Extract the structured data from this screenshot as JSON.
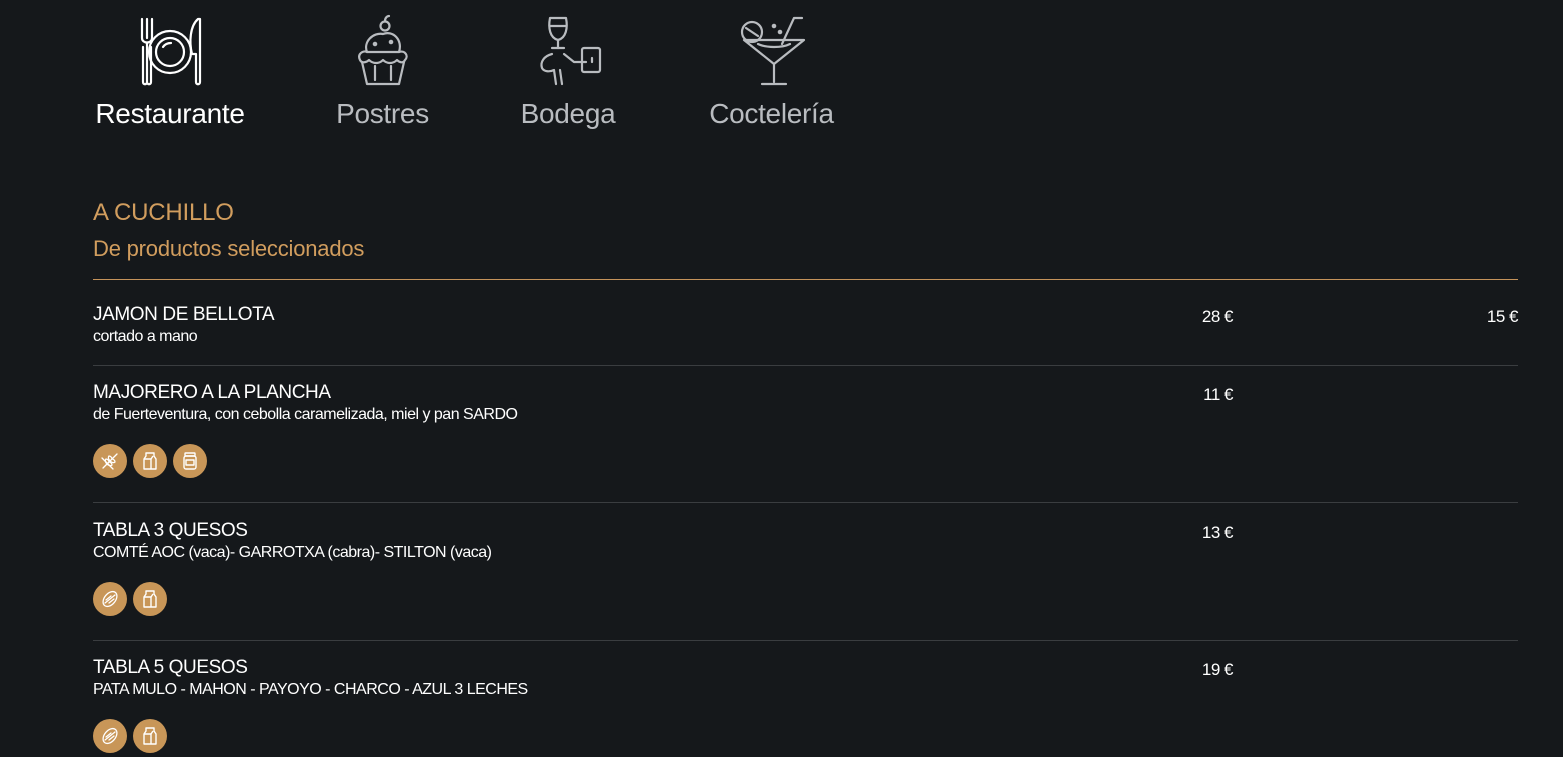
{
  "tabs": [
    {
      "label": "Restaurante",
      "icon": "cutlery-plate-icon",
      "active": true
    },
    {
      "label": "Postres",
      "icon": "cupcake-icon",
      "active": false
    },
    {
      "label": "Bodega",
      "icon": "wine-waiter-icon",
      "active": false
    },
    {
      "label": "Coctelería",
      "icon": "cocktail-icon",
      "active": false
    }
  ],
  "section": {
    "title": "A CUCHILLO",
    "subtitle": "De productos seleccionados"
  },
  "items": [
    {
      "name": "JAMON DE BELLOTA",
      "description": "cortado a mano",
      "price": "28 €",
      "price_secondary": "15 €",
      "allergens": []
    },
    {
      "name": "MAJORERO A LA PLANCHA",
      "description": "de Fuerteventura, con cebolla caramelizada, miel y pan SARDO",
      "price": "11 €",
      "price_secondary": "",
      "allergens": [
        "gluten-icon",
        "milk-icon",
        "honey-jar-icon"
      ]
    },
    {
      "name": "TABLA 3 QUESOS",
      "description": "COMTÉ AOC (vaca)- GARROTXA (cabra)- STILTON (vaca)",
      "price": "13 €",
      "price_secondary": "",
      "allergens": [
        "nuts-icon",
        "milk-icon"
      ]
    },
    {
      "name": "TABLA 5 QUESOS",
      "description": "PATA MULO - MAHON - PAYOYO - CHARCO - AZUL 3 LECHES",
      "price": "19 €",
      "price_secondary": "",
      "allergens": [
        "nuts-icon",
        "milk-icon"
      ]
    }
  ],
  "colors": {
    "background": "#15181b",
    "accent": "#d19d5e",
    "allergen_badge": "#c89658",
    "divider": "#3a3d40"
  }
}
